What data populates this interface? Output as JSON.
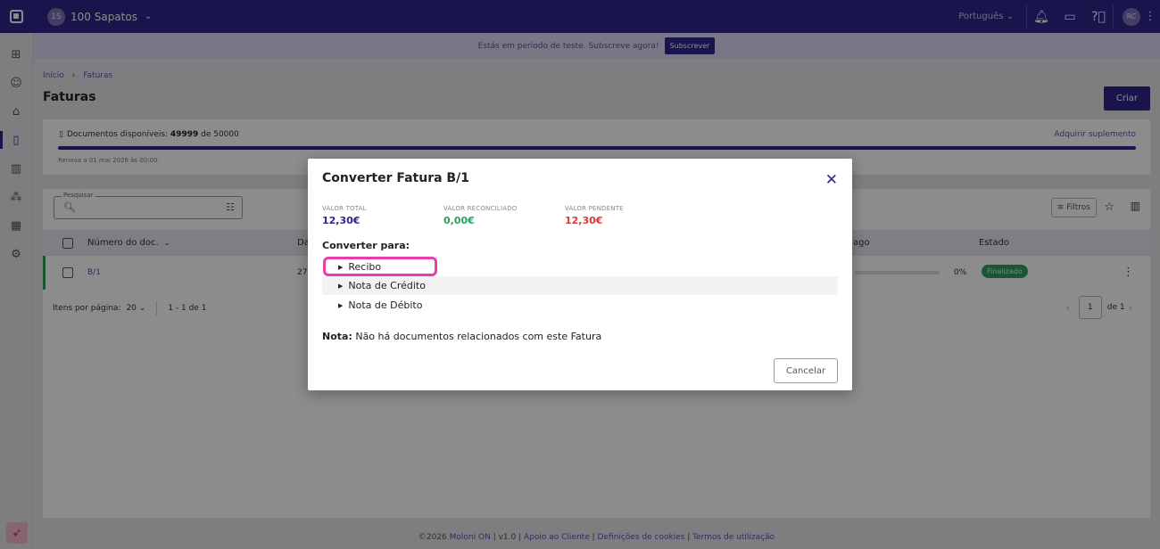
{
  "topbar": {
    "company_badge": "1S",
    "company_name": "100 Sapatos",
    "language": "Português",
    "user_initials": "RC"
  },
  "trial_banner": {
    "text": "Estás em período de teste. Subscreve agora!",
    "button": "Subscrever"
  },
  "breadcrumb": {
    "home": "Início",
    "current": "Faturas"
  },
  "page_title": "Faturas",
  "create_button": "Criar",
  "quota": {
    "label": "Documentos disponíveis:",
    "available": "49999",
    "of_text": "de 50000",
    "renew": "Renova a 01 mai 2026 às 00:00.",
    "supplement_link": "Adquirir suplemento",
    "used_fraction": 0.0
  },
  "table": {
    "search_label": "Pesquisar",
    "filters_label": "Filtros",
    "columns": [
      "Número do doc.",
      "Da",
      "ago",
      "Estado"
    ],
    "rows": [
      {
        "number": "B/1",
        "date_partial": "27",
        "paid_pct": "0%",
        "status": "Finalizado"
      }
    ],
    "per_page_label": "Itens por página:",
    "per_page": "20",
    "range": "1 - 1 de 1",
    "page": "1",
    "of_pages": "de 1"
  },
  "footer": {
    "copyright": "©2026",
    "brand": "Moloni ON",
    "version": "| v1.0 |",
    "support": "Apoio ao Cliente",
    "cookies": "Definições de cookies",
    "terms": "Termos de utilização"
  },
  "modal": {
    "title": "Converter Fatura B/1",
    "values": [
      {
        "caption": "VALOR TOTAL",
        "amount": "12,30€",
        "color": "#31258b"
      },
      {
        "caption": "VALOR RECONCILIADO",
        "amount": "0,00€",
        "color": "#2e9e5e"
      },
      {
        "caption": "VALOR PENDENTE",
        "amount": "12,30€",
        "color": "#d93a3a"
      }
    ],
    "convert_label": "Converter para:",
    "options": [
      "Recibo",
      "Nota de Crédito",
      "Nota de Débito"
    ],
    "note_bold": "Nota:",
    "note_text": " Não há documentos relacionados com este Fatura",
    "cancel": "Cancelar"
  },
  "colors": {
    "primary": "#31258b",
    "success": "#2e9e5e",
    "danger": "#d93a3a",
    "highlight": "#e83dab"
  }
}
